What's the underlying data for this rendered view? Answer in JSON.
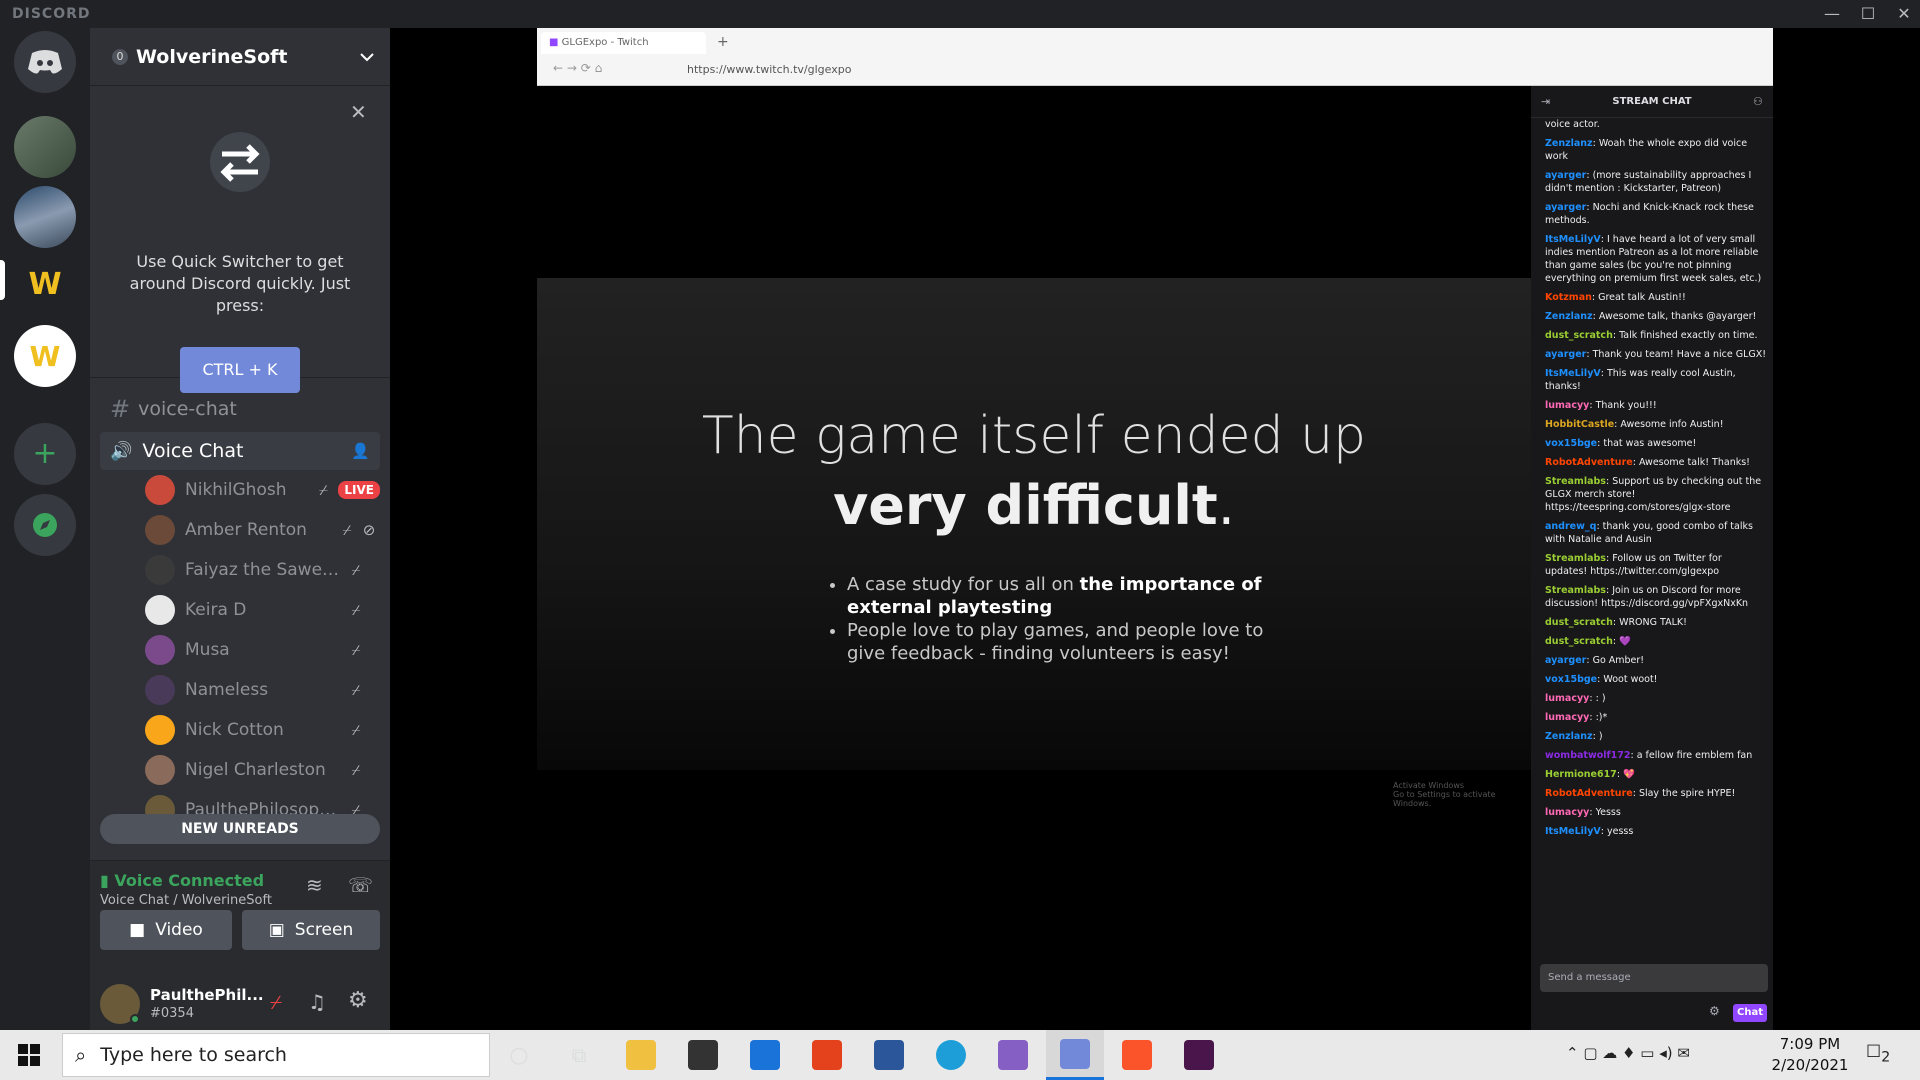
{
  "window": {
    "brand": "DISCORD",
    "min": "—",
    "max": "☐",
    "close": "✕"
  },
  "server": {
    "name": "WolverineSoft",
    "boost_badge": "0"
  },
  "quick_switcher": {
    "text": "Use Quick Switcher to get around Discord quickly. Just press:",
    "shortcut": "CTRL + K"
  },
  "channels": {
    "text": "voice-chat",
    "voice": "Voice Chat"
  },
  "members": [
    {
      "name": "NikhilGhosh",
      "badge": "LIVE",
      "color": "#c94a3a"
    },
    {
      "name": "Amber Renton",
      "color": "#6b4a3a"
    },
    {
      "name": "Faiyaz the Sawed of...",
      "color": "#3a3a3a"
    },
    {
      "name": "Keira D",
      "color": "#e8e8e8"
    },
    {
      "name": "Musa",
      "color": "#7a4a8a"
    },
    {
      "name": "Nameless",
      "color": "#4a3a5a"
    },
    {
      "name": "Nick Cotton",
      "color": "#faa61a"
    },
    {
      "name": "Nigel Charleston",
      "color": "#8a6a5a"
    },
    {
      "name": "PaulthePhilosophy...",
      "color": "#6a5a3a"
    }
  ],
  "new_unreads": "NEW UNREADS",
  "voice": {
    "status": "Voice Connected",
    "location": "Voice Chat / WolverineSoft",
    "video": "Video",
    "screen": "Screen"
  },
  "user": {
    "name": "PaulthePhil...",
    "tag": "#0354"
  },
  "browser": {
    "tab_title": "GLGExpo - Twitch",
    "url": "https://www.twitch.tv/glgexpo"
  },
  "slide": {
    "line1": "The game itself ended up",
    "line2": "very difficult",
    "line2_end": ".",
    "bullet1_pre": "A case study for us all on ",
    "bullet1_bold": "the importance of external playtesting",
    "bullet2": "People love to play games, and people love to give feedback - finding volunteers is easy!",
    "watermark1": "Activate Windows",
    "watermark2": "Go to Settings to activate Windows."
  },
  "chat": {
    "header": "STREAM CHAT",
    "placeholder": "Send a message",
    "button": "Chat",
    "messages": [
      {
        "user": "",
        "color": "#efeff1",
        "text": "voice actor."
      },
      {
        "user": "Zenzlanz",
        "color": "#1e90ff",
        "text": "Woah the whole expo did voice work"
      },
      {
        "user": "ayarger",
        "color": "#1e90ff",
        "text": "(more sustainability approaches I didn't mention : Kickstarter, Patreon)"
      },
      {
        "user": "ayarger",
        "color": "#1e90ff",
        "text": "Nochi and Knick-Knack rock these methods."
      },
      {
        "user": "ItsMeLilyV",
        "color": "#1e90ff",
        "text": "I have heard a lot of very small indies mention Patreon as a lot more reliable than game sales (bc you're not pinning everything on premium first week sales, etc.)"
      },
      {
        "user": "Kotzman",
        "color": "#ff4500",
        "text": "Great talk Austin!!"
      },
      {
        "user": "Zenzlanz",
        "color": "#1e90ff",
        "text": "Awesome talk, thanks @ayarger!"
      },
      {
        "user": "dust_scratch",
        "color": "#9acd32",
        "text": "Talk finished exactly on time."
      },
      {
        "user": "ayarger",
        "color": "#1e90ff",
        "text": "Thank you team! Have a nice GLGX!"
      },
      {
        "user": "ItsMeLilyV",
        "color": "#1e90ff",
        "text": "This was really cool Austin, thanks!"
      },
      {
        "user": "lumacyy",
        "color": "#ff69b4",
        "text": "Thank you!!!"
      },
      {
        "user": "HobbitCastle",
        "color": "#daa520",
        "text": "Awesome info Austin!"
      },
      {
        "user": "vox15bge",
        "color": "#1e90ff",
        "text": "that was awesome!"
      },
      {
        "user": "RobotAdventure",
        "color": "#ff4500",
        "text": "Awesome talk! Thanks!"
      },
      {
        "user": "Streamlabs",
        "color": "#9acd32",
        "text": "Support us by checking out the GLGX merch store! https://teespring.com/stores/glgx-store"
      },
      {
        "user": "andrew_q",
        "color": "#1e90ff",
        "text": "thank you, good combo of talks with Natalie and Ausin"
      },
      {
        "user": "Streamlabs",
        "color": "#9acd32",
        "text": "Follow us on Twitter for updates! https://twitter.com/glgexpo"
      },
      {
        "user": "Streamlabs",
        "color": "#9acd32",
        "text": "Join us on Discord for more discussion! https://discord.gg/vpFXgxNxKn"
      },
      {
        "user": "dust_scratch",
        "color": "#9acd32",
        "text": "WRONG TALK!"
      },
      {
        "user": "dust_scratch",
        "color": "#9acd32",
        "text": "💜"
      },
      {
        "user": "ayarger",
        "color": "#1e90ff",
        "text": "Go Amber!"
      },
      {
        "user": "vox15bge",
        "color": "#1e90ff",
        "text": "Woot woot!"
      },
      {
        "user": "lumacyy",
        "color": "#ff69b4",
        "text": ": )"
      },
      {
        "user": "lumacyy",
        "color": "#ff69b4",
        "text": ":)*"
      },
      {
        "user": "Zenzlanz",
        "color": "#1e90ff",
        "text": ")"
      },
      {
        "user": "wombatwolf172",
        "color": "#8a2be2",
        "text": "a fellow fire emblem fan"
      },
      {
        "user": "Hermione617",
        "color": "#9acd32",
        "text": "💖"
      },
      {
        "user": "RobotAdventure",
        "color": "#ff4500",
        "text": "Slay the spire HYPE!"
      },
      {
        "user": "lumacyy",
        "color": "#ff69b4",
        "text": "Yesss"
      },
      {
        "user": "ItsMeLilyV",
        "color": "#1e90ff",
        "text": "yesss"
      }
    ]
  },
  "taskbar": {
    "search_placeholder": "Type here to search",
    "time": "7:09 PM",
    "date": "2/20/2021",
    "notifications": "2"
  }
}
